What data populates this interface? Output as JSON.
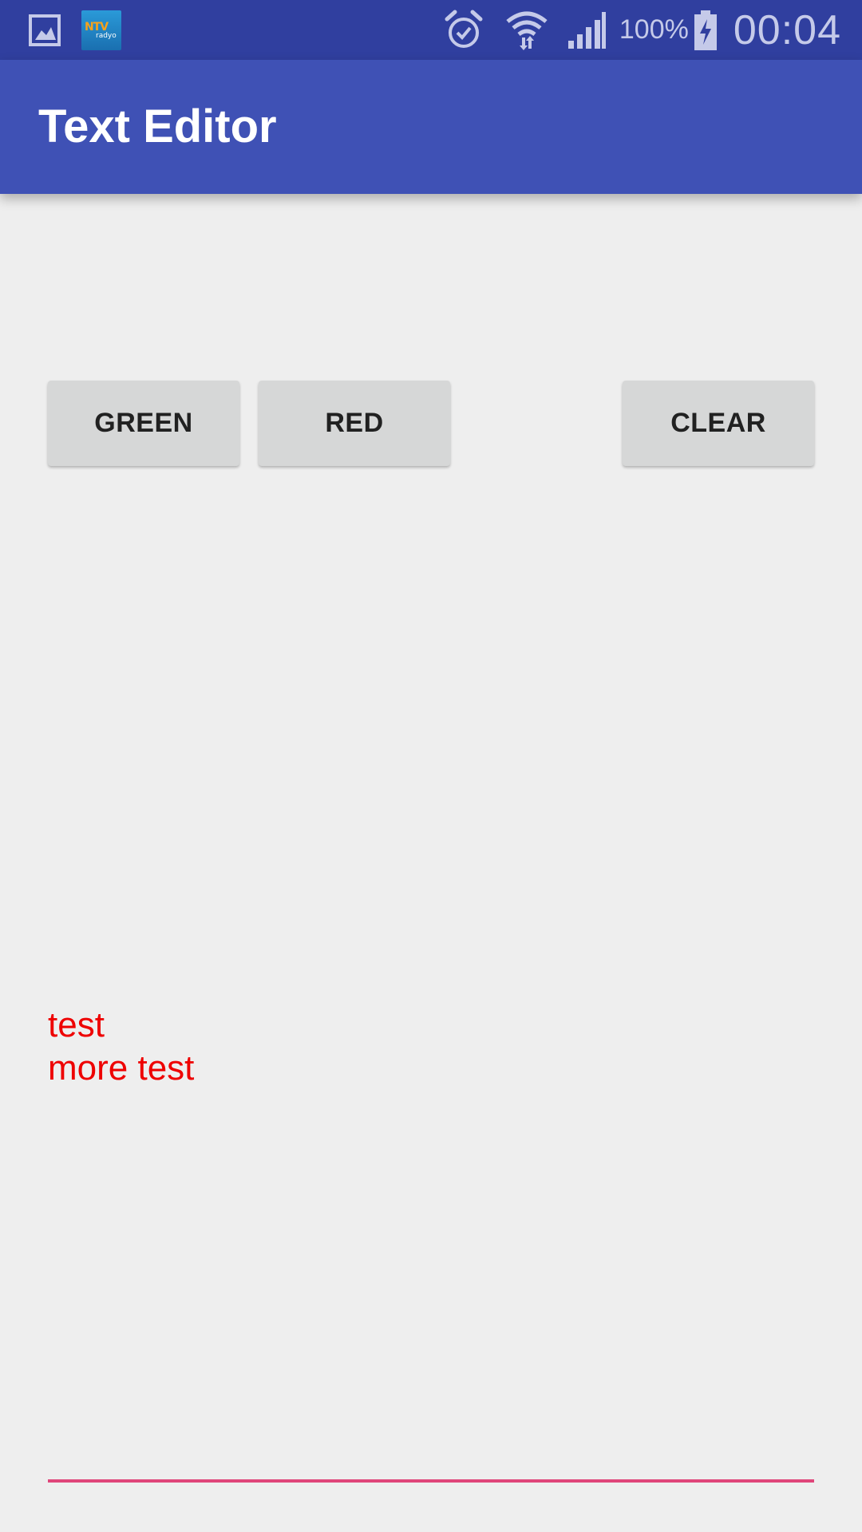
{
  "status_bar": {
    "notification_icons": [
      "gallery-icon",
      "ntv-radyo-icon"
    ],
    "ntv_badge_text": "NTV",
    "ntv_badge_sub": "radyo",
    "system_icons": [
      "alarm-icon",
      "wifi-icon",
      "signal-icon",
      "battery-charging-icon"
    ],
    "battery_percent": "100%",
    "time": "00:04",
    "background_color": "#303f9f"
  },
  "app_bar": {
    "title": "Text Editor",
    "background_color": "#3f51b5"
  },
  "buttons": {
    "green_label": "GREEN",
    "red_label": "RED",
    "clear_label": "CLEAR"
  },
  "editor": {
    "lines": [
      "test",
      "more test"
    ],
    "text_color": "#ee0000",
    "underline_color": "#e0457a"
  }
}
